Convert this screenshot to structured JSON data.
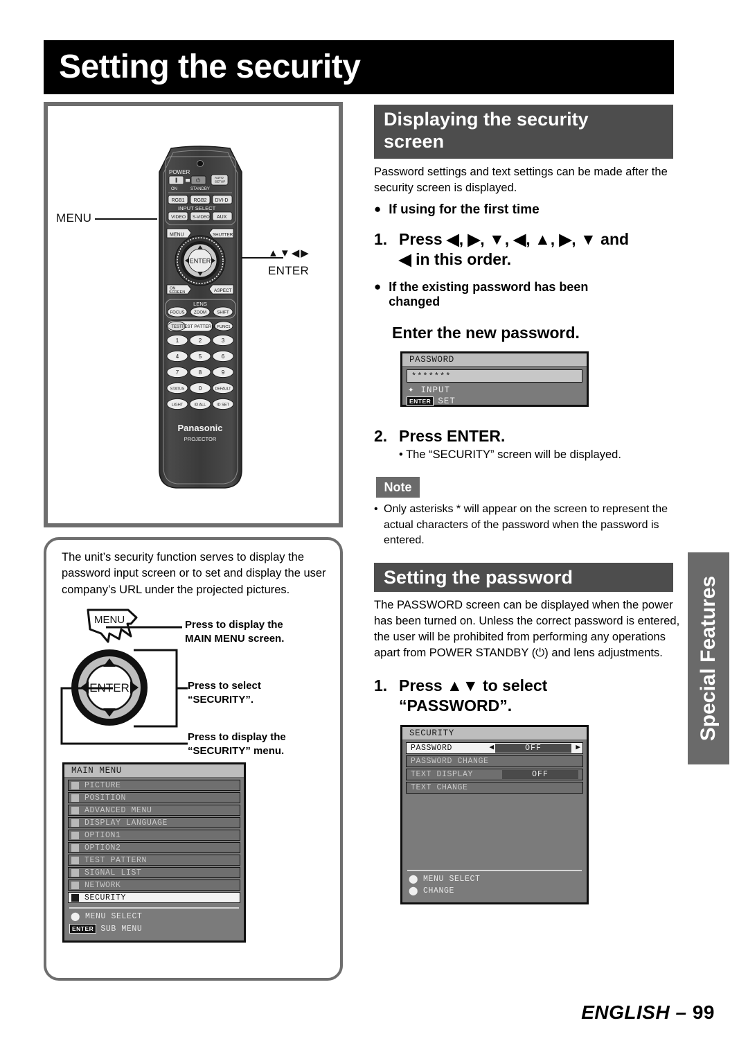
{
  "page": {
    "title": "Setting the security",
    "footer_language": "ENGLISH –",
    "footer_page": "99",
    "side_tab": "Special Features"
  },
  "remote_panel": {
    "callouts": {
      "menu": "MENU",
      "enter_arrows": "▲▼◀▶",
      "enter": "ENTER"
    },
    "remote": {
      "power_label": "POWER",
      "power_on": "I",
      "power_standby": "⏻",
      "on_label": "ON",
      "standby_label": "STANDBY",
      "auto_setup": "AUTO\nSETUP",
      "rgb1": "RGB1",
      "rgb2": "RGB2",
      "dvid": "DVI-D",
      "input_select": "INPUT SELECT",
      "video": "VIDEO",
      "svideo": "S-VIDEO",
      "aux": "AUX",
      "menu": "MENU",
      "shutter": "SHUTTER",
      "enter": "ENTER",
      "on_screen": "ON\nSCREEN",
      "aspect": "ASPECT",
      "lens": "LENS",
      "focus": "FOCUS",
      "zoom": "ZOOM",
      "shift": "SHIFT",
      "test": "TEST",
      "test_pattern": "TEST PATTERN",
      "func1": "FUNC1",
      "keys": [
        "1",
        "2",
        "3",
        "4",
        "5",
        "6",
        "7",
        "8",
        "9"
      ],
      "status": "STATUS",
      "zero": "0",
      "default": "DEFAULT",
      "light": "LIGHT",
      "id_all": "ID ALL",
      "id_set": "ID SET",
      "brand": "Panasonic",
      "brand_sub": "PROJECTOR"
    }
  },
  "info_box": {
    "paragraph": "The unit’s security function serves to display the password input screen or to set and display the user company’s URL under the projected pictures.",
    "menu_key": "MENU",
    "enter_key": "ENTER",
    "callout_1": "Press to display the MAIN MENU screen.",
    "callout_1_l1": "Press to display the",
    "callout_1_l2": "MAIN MENU screen.",
    "callout_2_l1": "Press to select",
    "callout_2_l2": "“SECURITY”.",
    "callout_3_l1": "Press to display the",
    "callout_3_l2": "“SECURITY” menu."
  },
  "main_menu_osd": {
    "title": "MAIN MENU",
    "items": [
      {
        "label": "PICTURE",
        "icon": "picture-icon",
        "selected": false
      },
      {
        "label": "POSITION",
        "icon": "position-icon",
        "selected": false
      },
      {
        "label": "ADVANCED MENU",
        "icon": "advanced-menu-icon",
        "selected": false
      },
      {
        "label": "DISPLAY LANGUAGE",
        "icon": "globe-icon",
        "selected": false
      },
      {
        "label": "OPTION1",
        "icon": "option-icon",
        "selected": false
      },
      {
        "label": "OPTION2",
        "icon": "option-icon",
        "selected": false
      },
      {
        "label": "TEST PATTERN",
        "icon": "test-pattern-icon",
        "selected": false
      },
      {
        "label": "SIGNAL LIST",
        "icon": "signal-list-icon",
        "selected": false
      },
      {
        "label": "NETWORK",
        "icon": "network-icon",
        "selected": false
      },
      {
        "label": "SECURITY",
        "icon": "key-icon",
        "selected": true
      }
    ],
    "footer_select": "MENU SELECT",
    "footer_enter_chip": "ENTER",
    "footer_submenu": "SUB MENU"
  },
  "security_screen": {
    "header_l1": "Displaying the security",
    "header_l2": "screen",
    "intro": "Password settings and text settings can be made after the security screen is displayed.",
    "bullet_1": "If using for the first time",
    "step_1_num": "1.",
    "step_1_l1": "Press ◀, ▶, ▼, ◀, ▲, ▶, ▼ and",
    "step_1_l2": "◀ in this order.",
    "bullet_2_l1": "If the existing password has been",
    "bullet_2_l2": "changed",
    "enter_new_password": "Enter the new password.",
    "step_2_num": "2.",
    "step_2_label": "Press ENTER.",
    "step_2_sub": "• The “SECURITY” screen will be displayed.",
    "note_badge": "Note",
    "note_text": "Only asterisks * will appear on the screen to represent the actual characters of the password when the password is entered.",
    "note_bullet": "•"
  },
  "password_osd": {
    "title": "PASSWORD",
    "value": "*******",
    "input_label": "INPUT",
    "set_chip": "ENTER",
    "set_label": "SET"
  },
  "setting_password": {
    "header": "Setting the password",
    "intro": "The PASSWORD screen can be displayed when the power has been turned on. Unless the correct password is entered, the user will be prohibited from performing any operations apart from POWER STANDBY (⏻) and lens adjustments.",
    "step_1_num": "1.",
    "step_1_l1": "Press ▲▼ to select",
    "step_1_l2": "“PASSWORD”."
  },
  "security_osd": {
    "title": "SECURITY",
    "rows": [
      {
        "label": "PASSWORD",
        "value": "OFF",
        "selected": true,
        "arrows": true
      },
      {
        "label": "PASSWORD CHANGE",
        "value": "",
        "selected": false,
        "arrows": false
      },
      {
        "label": "TEXT DISPLAY",
        "value": "OFF",
        "selected": false,
        "arrows": false
      },
      {
        "label": "TEXT CHANGE",
        "value": "",
        "selected": false,
        "arrows": false
      }
    ],
    "footer_select": "MENU SELECT",
    "footer_change": "CHANGE"
  },
  "colors": {
    "banner": "#000000",
    "section_header": "#4d4d4d",
    "frame_border": "#6e6e6e",
    "osd_bg": "#7b7b7b",
    "osd_title_bg": "#bdbdbd",
    "side_tab": "#6a6a6a"
  }
}
